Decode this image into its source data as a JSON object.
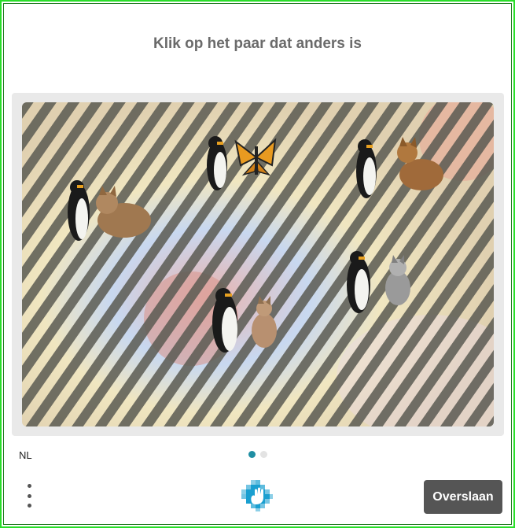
{
  "prompt": "Klik op het paar dat anders is",
  "language": "NL",
  "pager": {
    "total": 2,
    "current": 1
  },
  "skip_label": "Overslaan",
  "icons": {
    "menu": "more-vertical-icon",
    "logo": "hcaptcha-hand-logo"
  },
  "colors": {
    "accent": "#1f8ea3",
    "button": "#555555",
    "frame": "#2adf2a",
    "prompt_text": "#6b6b6b"
  },
  "challenge": {
    "pairs": [
      {
        "id": "pair-penguin-cat-left",
        "a": "penguin",
        "b": "cat"
      },
      {
        "id": "pair-penguin-butterfly",
        "a": "penguin",
        "b": "butterfly"
      },
      {
        "id": "pair-penguin-cat-top-right",
        "a": "penguin",
        "b": "cat"
      },
      {
        "id": "pair-penguin-cat-center",
        "a": "penguin",
        "b": "cat"
      },
      {
        "id": "pair-penguin-cat-right",
        "a": "penguin",
        "b": "cat"
      }
    ]
  }
}
